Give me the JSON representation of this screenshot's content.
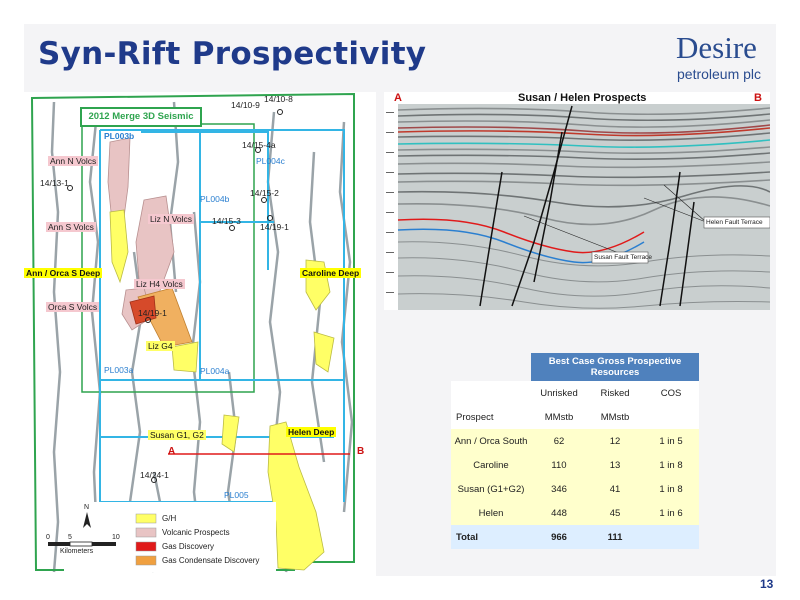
{
  "slide": {
    "title": "Syn-Rift Prospectivity",
    "page_number": "13",
    "logo": {
      "main": "Desire",
      "sub": "petroleum plc"
    }
  },
  "map": {
    "merge_label": "2012 Merge 3D Seismic",
    "wells": [
      "14/10-9",
      "14/10-8",
      "14/15-4a",
      "14/15-2",
      "14/19-1",
      "14/15-3",
      "14/13-1",
      "14/19-1",
      "14/24-1"
    ],
    "licences": [
      "PL003b",
      "PL004c",
      "PL004b",
      "PL003a",
      "PL004a",
      "PL005"
    ],
    "prospects": {
      "ann_n": "Ann N Volcs",
      "ann_s": "Ann S Volcs",
      "liz_n": "Liz N Volcs",
      "ann_orca": "Ann / Orca S Deep",
      "caroline": "Caroline Deep",
      "liz_h4": "Liz H4 Volcs",
      "orca_s": "Orca S Volcs",
      "liz_g4": "Liz G4",
      "susan": "Susan G1, G2",
      "helen": "Helen Deep"
    },
    "section_a": "A",
    "section_b": "B",
    "north": "N",
    "scale": {
      "ticks": [
        "0",
        "5",
        "10"
      ],
      "unit": "Kilometers"
    },
    "legend": [
      {
        "label": "G/H",
        "color": "#ffff66"
      },
      {
        "label": "Volcanic Prospects",
        "color": "#e8c4c4"
      },
      {
        "label": "Gas Discovery",
        "color": "#e01a1a"
      },
      {
        "label": "Gas Condensate Discovery",
        "color": "#f0a040"
      }
    ]
  },
  "seismic": {
    "title": "Susan / Helen Prospects",
    "a": "A",
    "b": "B",
    "callouts": {
      "helen": "Helen Fault Terrace",
      "susan": "Susan Fault Terrace"
    }
  },
  "table": {
    "group_header": "Best Case Gross Prospective Resources",
    "col_headers": [
      "Unrisked",
      "Risked",
      "COS"
    ],
    "unit_row": {
      "label": "Prospect",
      "unrisked": "MMstb",
      "risked": "MMstb",
      "cos": ""
    },
    "rows": [
      {
        "prospect": "Ann / Orca South",
        "unrisked": "62",
        "risked": "12",
        "cos": "1 in 5"
      },
      {
        "prospect": "Caroline",
        "unrisked": "110",
        "risked": "13",
        "cos": "1 in 8"
      },
      {
        "prospect": "Susan (G1+G2)",
        "unrisked": "346",
        "risked": "41",
        "cos": "1 in 8"
      },
      {
        "prospect": "Helen",
        "unrisked": "448",
        "risked": "45",
        "cos": "1 in 6"
      }
    ],
    "total": {
      "label": "Total",
      "unrisked": "966",
      "risked": "111",
      "cos": ""
    }
  }
}
